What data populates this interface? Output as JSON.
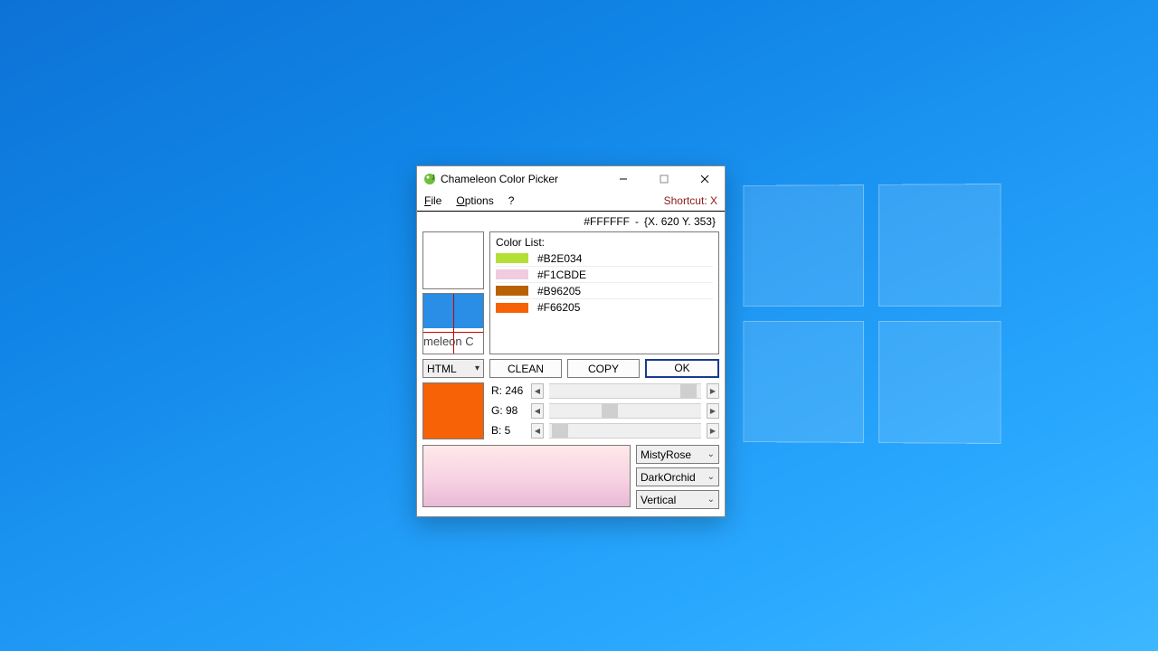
{
  "desktop": {
    "logo_present": true
  },
  "window": {
    "title": "Chameleon Color Picker",
    "menu": {
      "file": "File",
      "options": "Options",
      "help": "?",
      "shortcut": "Shortcut: X"
    },
    "status": {
      "hex": "#FFFFFF",
      "sep": "-",
      "coords": "{X. 620 Y. 353}"
    },
    "color_list": {
      "label": "Color List:",
      "items": [
        {
          "hex": "#B2E034",
          "swatch": "#b2e034"
        },
        {
          "hex": "#F1CBDE",
          "swatch": "#f1cbde"
        },
        {
          "hex": "#B96205",
          "swatch": "#b96205"
        },
        {
          "hex": "#F66205",
          "swatch": "#f66205"
        }
      ]
    },
    "magnifier_caption": "meleon C",
    "format_selector": "HTML",
    "buttons": {
      "clean": "CLEAN",
      "copy": "COPY",
      "ok": "OK"
    },
    "current_swatch": "#f66205",
    "rgb": {
      "r": {
        "label": "R: 246",
        "value": 246,
        "max": 255
      },
      "g": {
        "label": "G: 98",
        "value": 98,
        "max": 255
      },
      "b": {
        "label": "B: 5",
        "value": 5,
        "max": 255
      }
    },
    "gradient": {
      "color1": "MistyRose",
      "color2": "DarkOrchid",
      "direction": "Vertical"
    }
  }
}
